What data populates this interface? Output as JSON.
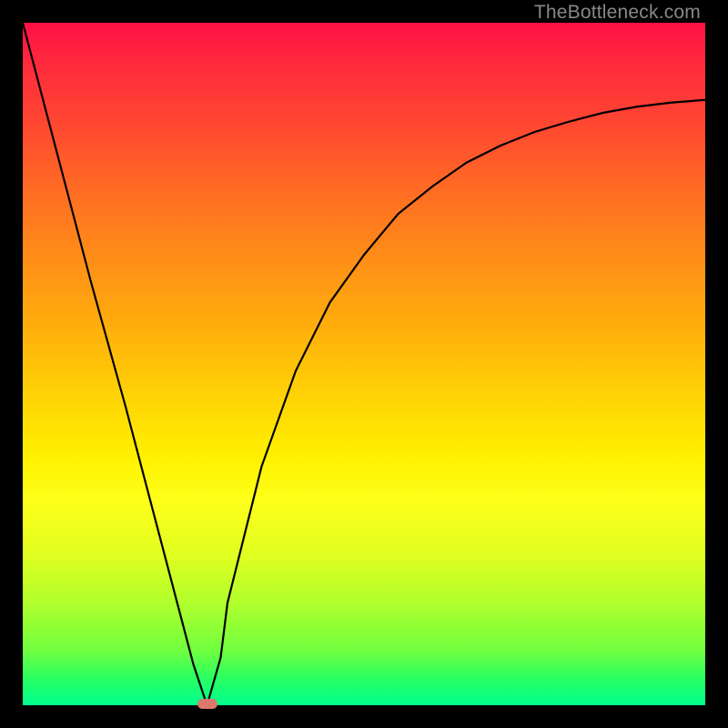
{
  "watermark": "TheBottleneck.com",
  "colors": {
    "frame": "#000000",
    "curve": "#000000",
    "marker": "#d97a6a"
  },
  "chart_data": {
    "type": "line",
    "title": "",
    "xlabel": "",
    "ylabel": "",
    "xlim": [
      0,
      100
    ],
    "ylim": [
      0,
      100
    ],
    "grid": false,
    "legend": false,
    "series": [
      {
        "name": "bottleneck-curve",
        "x": [
          0,
          5,
          10,
          15,
          20,
          25,
          27,
          29,
          30,
          35,
          40,
          45,
          50,
          55,
          60,
          65,
          70,
          75,
          80,
          85,
          90,
          95,
          100
        ],
        "values": [
          100,
          81,
          62,
          44,
          25,
          6,
          0,
          7,
          15,
          35,
          49,
          59,
          66,
          72,
          76,
          79.5,
          82,
          84,
          85.5,
          86.8,
          87.7,
          88.3,
          88.7
        ]
      }
    ],
    "annotations": [
      {
        "name": "minimum-marker",
        "x": 27,
        "y": 0
      }
    ]
  }
}
